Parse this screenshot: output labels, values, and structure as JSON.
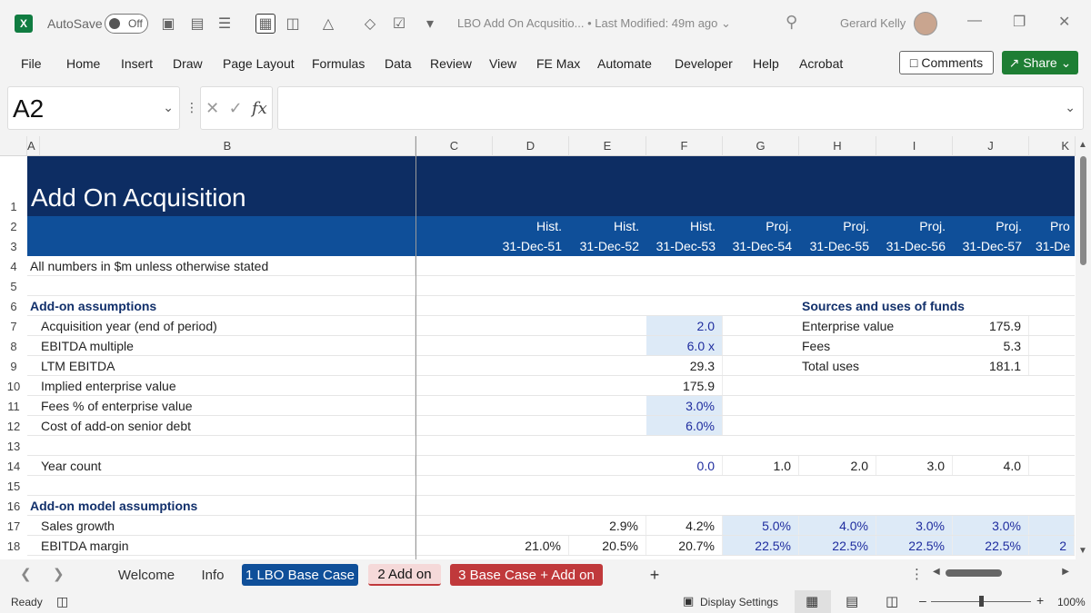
{
  "titlebar": {
    "app_logo": "X",
    "autosave_label": "AutoSave",
    "autosave_state": "Off",
    "doc_title": "LBO Add On Acqusitio... • Last Modified: 49m ago ⌄",
    "user_name": "Gerard Kelly"
  },
  "menu": [
    "File",
    "Home",
    "Insert",
    "Draw",
    "Page Layout",
    "Formulas",
    "Data",
    "Review",
    "View",
    "FE Max",
    "Automate",
    "Developer",
    "Help",
    "Acrobat"
  ],
  "buttons": {
    "comments": "Comments",
    "share": "Share"
  },
  "formula_bar": {
    "name_box": "A2",
    "fx": "fx",
    "formula": ""
  },
  "columns": [
    "A",
    "B",
    "C",
    "D",
    "E",
    "F",
    "G",
    "H",
    "I",
    "J",
    "K"
  ],
  "rows": [
    "1",
    "2",
    "3",
    "4",
    "5",
    "6",
    "7",
    "8",
    "9",
    "10",
    "11",
    "12",
    "13",
    "14",
    "15",
    "16",
    "17",
    "18"
  ],
  "sheet": {
    "title": "Add On Acquisition",
    "period_types": [
      "Hist.",
      "Hist.",
      "Hist.",
      "Proj.",
      "Proj.",
      "Proj.",
      "Proj.",
      "Pro"
    ],
    "period_dates": [
      "31-Dec-51",
      "31-Dec-52",
      "31-Dec-53",
      "31-Dec-54",
      "31-Dec-55",
      "31-Dec-56",
      "31-Dec-57",
      "31-De"
    ],
    "note": "All numbers in $m unless otherwise stated",
    "addon_header": "Add-on assumptions",
    "acq_year_label": "Acquisition year (end of period)",
    "acq_year_value": "2.0",
    "ebitda_mult_label": "EBITDA multiple",
    "ebitda_mult_value": "6.0 x",
    "ltm_label": "LTM EBITDA",
    "ltm_value": "29.3",
    "iev_label": "Implied enterprise value",
    "iev_value": "175.9",
    "fees_label": "Fees % of enterprise value",
    "fees_value": "3.0%",
    "cost_label": "Cost of add-on senior debt",
    "cost_value": "6.0%",
    "su_header": "Sources and uses of funds",
    "su_ev_label": "Enterprise value",
    "su_ev_value": "175.9",
    "su_fees_label": "Fees",
    "su_fees_value": "5.3",
    "su_total_label": "Total uses",
    "su_total_value": "181.1",
    "year_count_label": "Year count",
    "year_count": [
      "0.0",
      "1.0",
      "2.0",
      "3.0",
      "4.0"
    ],
    "model_header": "Add-on model assumptions",
    "sales_growth_label": "Sales growth",
    "sales_growth": [
      "2.9%",
      "4.2%",
      "5.0%",
      "4.0%",
      "3.0%",
      "3.0%"
    ],
    "ebitda_margin_label": "EBITDA margin",
    "ebitda_margin": [
      "21.0%",
      "20.5%",
      "20.7%",
      "22.5%",
      "22.5%",
      "22.5%",
      "22.5%",
      "2"
    ]
  },
  "tabs": {
    "welcome": "Welcome",
    "info": "Info",
    "base": "1 LBO Base Case",
    "addon": "2 Add on",
    "combined": "3 Base Case + Add on",
    "add": "+"
  },
  "status": {
    "ready": "Ready",
    "display_settings": "Display Settings",
    "zoom": "100%"
  },
  "colors": {
    "title_bg": "#0d2d63",
    "header_bg": "#0f4f99",
    "input_bg": "#ddeaf7",
    "share_green": "#1e7e34",
    "tab_base": "#0f4f99",
    "tab_combined": "#c0393b",
    "tab_active": "#f5d9d9"
  }
}
